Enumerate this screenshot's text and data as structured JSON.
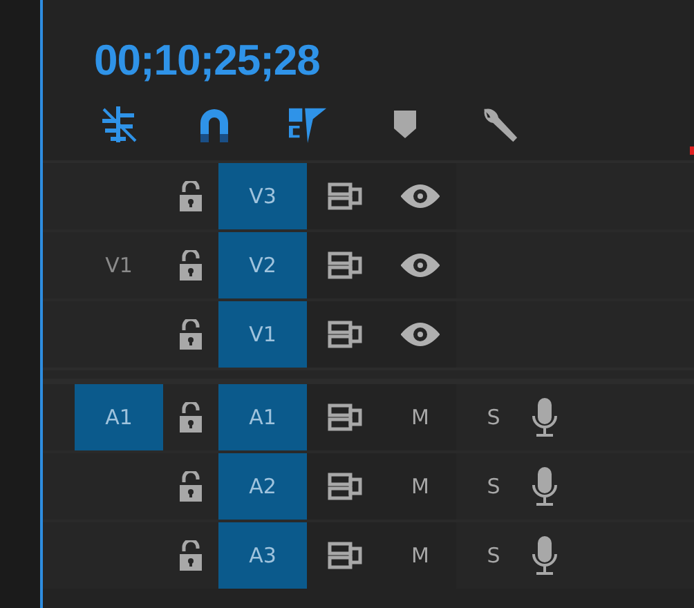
{
  "timecode": "00;10;25;28",
  "toolbar": [
    {
      "kind": "nest",
      "active": true
    },
    {
      "kind": "snap",
      "active": true
    },
    {
      "kind": "linked",
      "active": true
    },
    {
      "kind": "marker",
      "active": false
    },
    {
      "kind": "settings",
      "active": false
    }
  ],
  "video_tracks": [
    {
      "locked": false,
      "target": "V3",
      "targeted": true,
      "visible": true
    },
    {
      "source": {
        "label": "V1",
        "selected": false
      },
      "locked": false,
      "target": "V2",
      "targeted": true,
      "visible": true
    },
    {
      "locked": false,
      "target": "V1",
      "targeted": true,
      "visible": true
    }
  ],
  "audio_tracks": [
    {
      "source": {
        "label": "A1",
        "selected": true
      },
      "locked": false,
      "target": "A1",
      "targeted": true,
      "mute": "M",
      "muted": false,
      "solo": "S",
      "soloed": false
    },
    {
      "locked": false,
      "target": "A2",
      "targeted": true,
      "mute": "M",
      "muted": false,
      "solo": "S",
      "soloed": false
    },
    {
      "locked": false,
      "target": "A3",
      "targeted": true,
      "mute": "M",
      "muted": false,
      "solo": "S",
      "soloed": false
    }
  ]
}
